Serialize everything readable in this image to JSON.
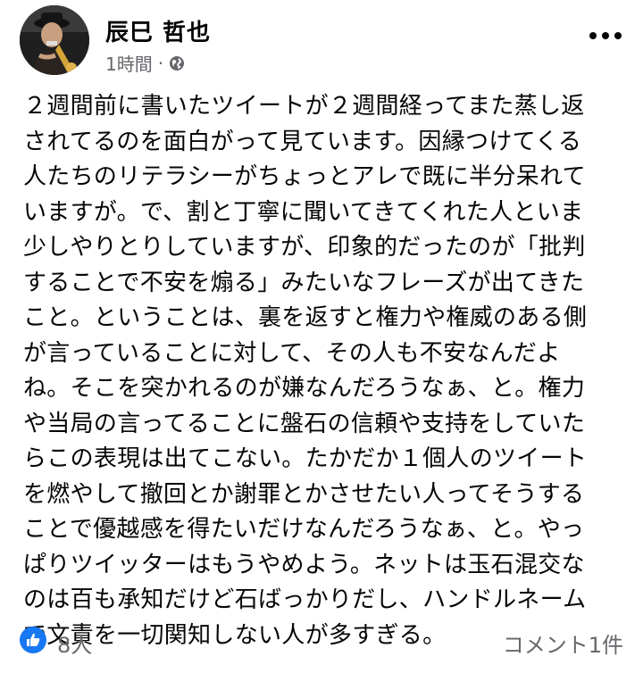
{
  "post": {
    "author": "辰巳 哲也",
    "timestamp": "1時間",
    "separator": "·",
    "privacy_icon": "globe-icon",
    "more_icon": "more-dots-icon",
    "body": "２週間前に書いたツイートが２週間経ってまた蒸し返\nされてるのを面白がって見ています。因縁つけてくる\n人たちのリテラシーがちょっとアレで既に半分呆れて\nいますが。で、割と丁寧に聞いてきてくれた人といま\n少しやりとりしていますが、印象的だったのが「批判\nすることで不安を煽る」みたいなフレーズが出てきた\nこと。ということは、裏を返すと権力や権威のある側\nが言っていることに対して、その人も不安なんだよ\nね。そこを突かれるのが嫌なんだろうなぁ、と。権力\nや当局の言ってることに盤石の信頼や支持をしていた\nらこの表現は出てこない。たかだか１個人のツイート\nを燃やして撤回とか謝罪とかさせたい人ってそうする\nことで優越感を得たいだけなんだろうなぁ、と。やっ\nぱりツイッターはもうやめよう。ネットは玉石混交な\nのは百も承知だけど石ばっかりだし、ハンドルネーム\nで文責を一切関知しない人が多すぎる。"
  },
  "footer": {
    "like_icon": "thumbs-up-icon",
    "reactions": "8人",
    "comments": "コメント1件"
  },
  "colors": {
    "text": "#050505",
    "secondary": "#65676b",
    "like_blue": "#1877f2"
  }
}
